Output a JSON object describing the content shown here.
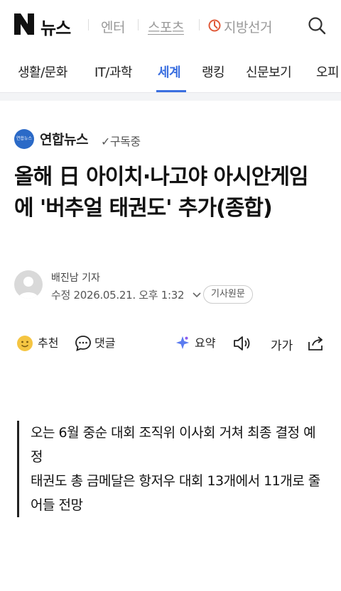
{
  "header": {
    "logo_letter": "N",
    "logo_text": "뉴스",
    "nav": [
      "엔터",
      "스포츠",
      "지방선거"
    ]
  },
  "categories": {
    "items": [
      "생활/문화",
      "IT/과학",
      "세계",
      "랭킹",
      "신문보기",
      "오피"
    ],
    "active": "세계",
    "accent_color": "#3b6fe0"
  },
  "press": {
    "logo_text": "연합뉴스",
    "name": "연합뉴스",
    "subscribe_label": "✓구독중"
  },
  "article": {
    "title": "올해 日 아이치·나고야 아시안게임에 '버추얼 태권도' 추가(종합)",
    "reporter": "배진남 기자",
    "updated": "수정 2026.05.21. 오후 1:32",
    "original_label": "기사원문",
    "summary": [
      "오는 6월 중순 대회 조직위 이사회 거쳐 최종 결정 예정",
      "태권도 총 금메달은 항저우 대회 13개에서 11개로 줄어들 전망"
    ]
  },
  "toolbar": {
    "recommend": "추천",
    "comment": "댓글",
    "summary": "요약",
    "font_label": "가가"
  }
}
